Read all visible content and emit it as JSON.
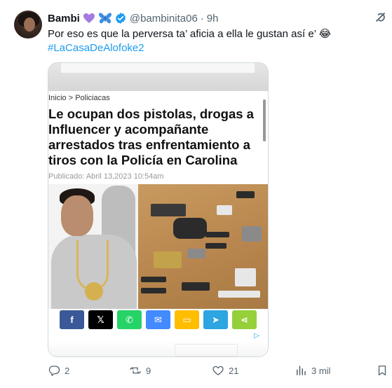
{
  "author": {
    "name": "Bambi",
    "emojis": [
      "purple-heart",
      "blue-butterfly"
    ],
    "handle": "@bambinita06",
    "dot": "·",
    "time": "9h"
  },
  "tweet": {
    "text": "Por eso es que la perversa ta’ aficia a ella le gustan así e’ 😂",
    "hashtag": "#LaCasaDeAlofoke2"
  },
  "article": {
    "breadcrumb": "Inicio > Policiacas",
    "headline": "Le ocupan dos pistolas, drogas a Influencer y acompañante arrestados tras enfrentamiento a tiros con la Policía en Carolina",
    "published": "Publicado: Abril 13,2023 10:54am",
    "share_buttons": [
      {
        "name": "facebook",
        "label": "f",
        "color": "#3b5998"
      },
      {
        "name": "x",
        "label": "𝕏",
        "color": "#000000"
      },
      {
        "name": "whatsapp",
        "label": "✆",
        "color": "#25d366"
      },
      {
        "name": "messenger",
        "label": "✉",
        "color": "#448aff"
      },
      {
        "name": "sms",
        "label": "▭",
        "color": "#ffbd00"
      },
      {
        "name": "telegram",
        "label": "➤",
        "color": "#2ca5e0"
      },
      {
        "name": "sharethis",
        "label": "⋖",
        "color": "#95d03a"
      }
    ],
    "ad_marker": "▷"
  },
  "metrics": {
    "replies": "2",
    "reposts": "9",
    "likes": "21",
    "views": "3 mil"
  },
  "colors": {
    "accent": "#1d9bf0",
    "text": "#0f1419",
    "muted": "#536471"
  }
}
